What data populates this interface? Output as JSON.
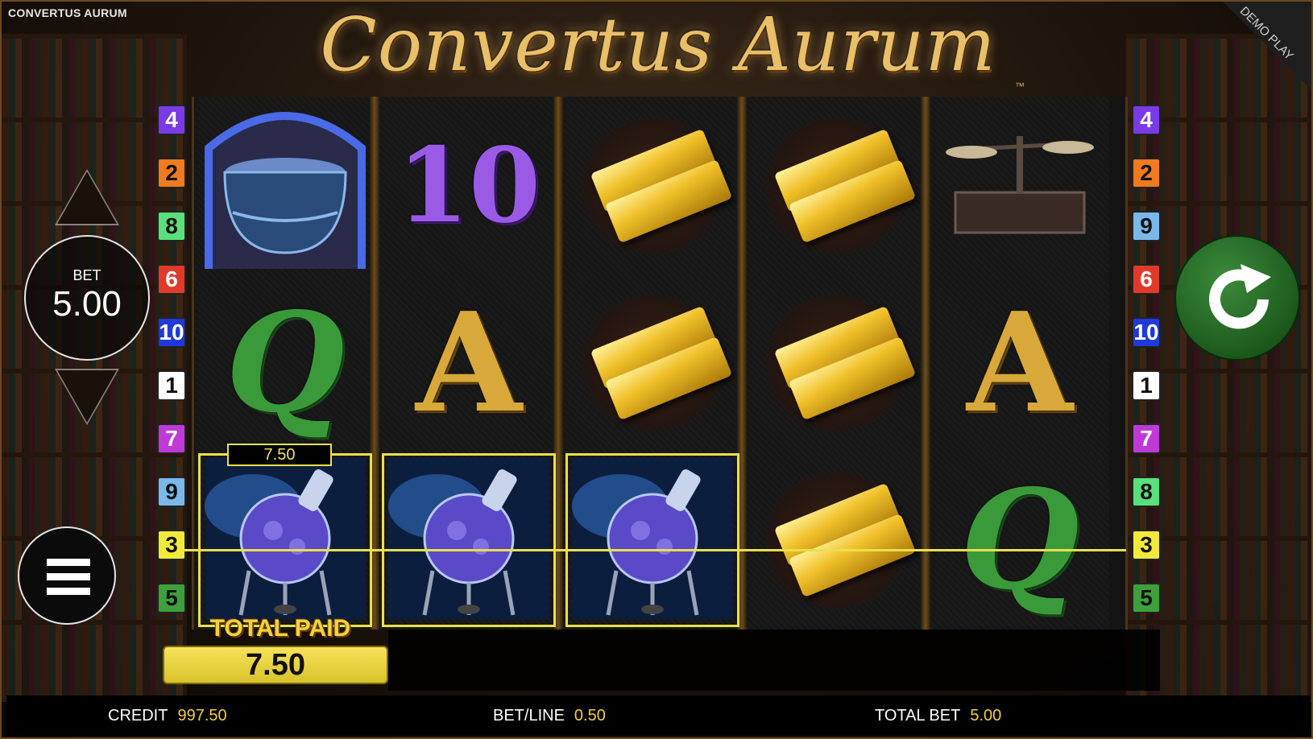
{
  "app_title": "CONVERTUS AURUM",
  "logo": {
    "text": "Convertus Aurum",
    "tm": "™"
  },
  "demo_label": "DEMO PLAY",
  "bet_control": {
    "label": "BET",
    "value": "5.00"
  },
  "paylines_left": [
    "4",
    "2",
    "8",
    "6",
    "10",
    "1",
    "7",
    "9",
    "3",
    "5"
  ],
  "paylines_right": [
    "4",
    "2",
    "9",
    "6",
    "10",
    "1",
    "7",
    "8",
    "3",
    "5"
  ],
  "payline_colors": {
    "1": "#ffffff",
    "2": "#f07a1e",
    "3": "#f2ea3a",
    "4": "#7a3ae6",
    "5": "#3ea03a",
    "6": "#e03a2a",
    "7": "#c03ad8",
    "8": "#5ae07a",
    "9": "#7ab8ea",
    "10": "#1e3ad8"
  },
  "reels": [
    [
      "cauldron",
      "Q",
      "flask"
    ],
    [
      "10",
      "A",
      "flask"
    ],
    [
      "gold",
      "gold",
      "flask"
    ],
    [
      "gold",
      "gold",
      "gold"
    ],
    [
      "scales",
      "A",
      "Q"
    ]
  ],
  "winning_cells": [
    [
      0,
      2
    ],
    [
      1,
      2
    ],
    [
      2,
      2
    ]
  ],
  "line_win": "7.50",
  "total_paid": {
    "label": "TOTAL PAID",
    "value": "7.50"
  },
  "status": {
    "credit_label": "CREDIT",
    "credit_value": "997.50",
    "betline_label": "BET/LINE",
    "betline_value": "0.50",
    "totalbet_label": "TOTAL BET",
    "totalbet_value": "5.00"
  },
  "colors": {
    "accent": "#e9e04b",
    "value_text": "#f2cf3a",
    "spin_button": "#2a6e2a"
  }
}
